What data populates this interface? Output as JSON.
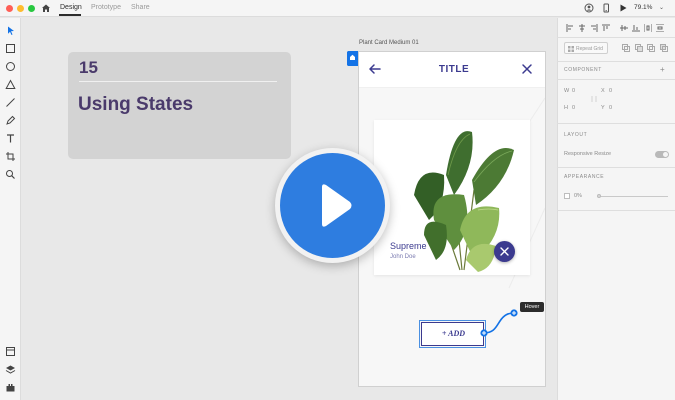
{
  "titlebar": {
    "tabs": [
      {
        "label": "Design"
      },
      {
        "label": "Prototype"
      },
      {
        "label": "Share"
      }
    ],
    "zoom": "79.1%",
    "icons": [
      "home-icon",
      "user-icon",
      "phone-icon",
      "play-icon"
    ]
  },
  "toolbar": {
    "tools": [
      "select-icon",
      "rectangle-icon",
      "ellipse-icon",
      "triangle-icon",
      "line-icon",
      "pen-icon",
      "text-icon",
      "artboard-icon",
      "zoom-icon"
    ],
    "bottom_tools": [
      "assets-icon",
      "layers-icon",
      "plugins-icon"
    ]
  },
  "lesson": {
    "number": "15",
    "title": "Using States"
  },
  "artboard": {
    "label": "Plant Card Medium 01",
    "title": "TITLE",
    "card": {
      "name": "Supreme",
      "owner": "John Doe"
    },
    "add_label": "+ ADD",
    "hover_tag": "Hover"
  },
  "panel": {
    "repeat_grid": "Repeat Grid",
    "component_header": "COMPONENT",
    "w_label": "W",
    "w_value": "0",
    "h_label": "H",
    "h_value": "0",
    "x_label": "X",
    "x_value": "0",
    "y_label": "Y",
    "y_value": "0",
    "layout_header": "LAYOUT",
    "responsive_resize": "Responsive Resize",
    "appearance_header": "APPEARANCE",
    "opacity": "0%"
  },
  "colors": {
    "accent": "#3b3a8f",
    "play": "#2e7de0",
    "selection": "#1473e6",
    "lesson_text": "#4a3a6b"
  }
}
